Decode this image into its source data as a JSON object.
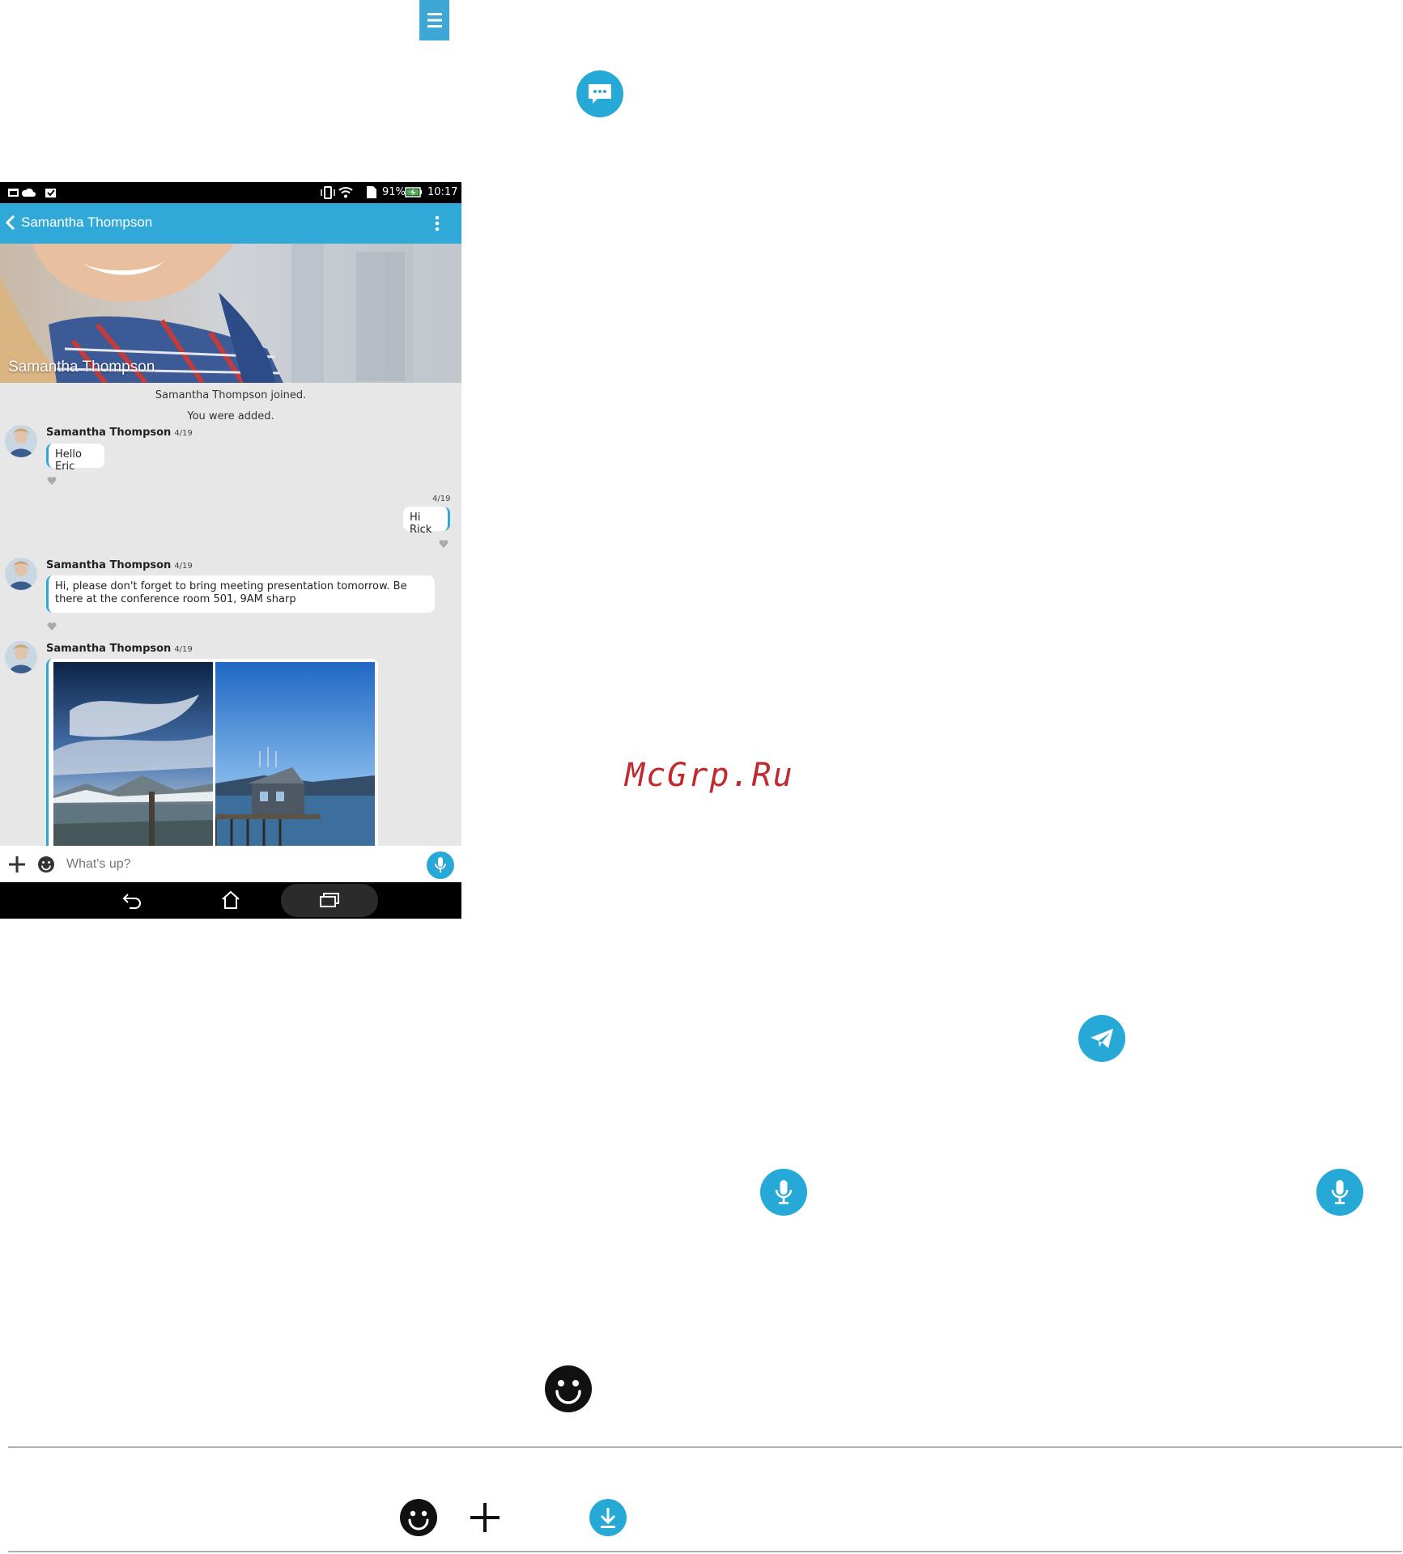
{
  "phone": {
    "status": {
      "battery": "91%",
      "time": "10:17"
    },
    "app_bar": {
      "title": "Samantha Thompson"
    },
    "hero": {
      "name": "Samantha Thompson"
    },
    "system_messages": [
      "Samantha Thompson joined.",
      "You were added."
    ],
    "messages": [
      {
        "sender": "Samantha Thompson",
        "date": "4/19",
        "text": "Hello Eric"
      },
      {
        "date": "4/19",
        "text": "Hi Rick"
      },
      {
        "sender": "Samantha Thompson",
        "date": "4/19",
        "text": "Hi, please don't forget to bring meeting presentation tomorrow. Be there at the conference room 501, 9AM sharp"
      },
      {
        "sender": "Samantha Thompson",
        "date": "4/19"
      }
    ],
    "input": {
      "placeholder": "What's up?"
    }
  },
  "watermark": "McGrp.Ru",
  "icons": {
    "menu": "menu-icon",
    "chat": "chat-bubble-icon",
    "send": "send-plane-icon",
    "mic": "mic-icon",
    "emoji": "emoji-icon",
    "plus": "plus-icon",
    "download": "download-icon"
  },
  "colors": {
    "accent": "#27a9d8",
    "watermark": "#c0292d"
  }
}
